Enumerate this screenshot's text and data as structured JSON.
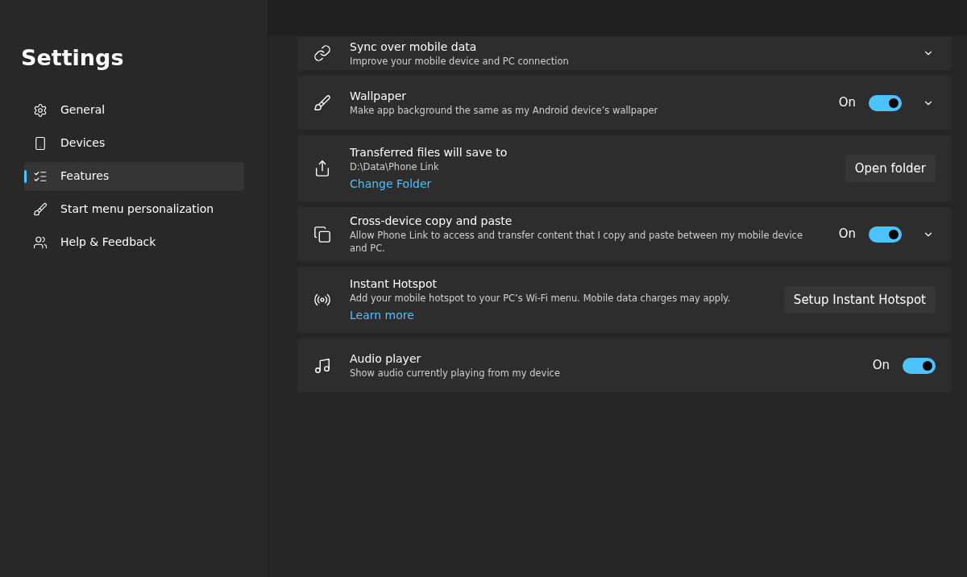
{
  "sidebar": {
    "title": "Settings",
    "items": [
      {
        "label": "General",
        "selected": false
      },
      {
        "label": "Devices",
        "selected": false
      },
      {
        "label": "Features",
        "selected": true
      },
      {
        "label": "Start menu personalization",
        "selected": false
      },
      {
        "label": "Help & Feedback",
        "selected": false
      }
    ]
  },
  "cards": [
    {
      "title": "Sync over mobile data",
      "description": "Improve your mobile device and PC connection",
      "expandable": true
    },
    {
      "title": "Wallpaper",
      "description": "Make app background the same as my Android device’s wallpaper",
      "control": {
        "kind": "toggle",
        "label": "On",
        "on": true
      },
      "expandable": true
    },
    {
      "title": "Transferred files will save to",
      "description": "D:\\Data\\Phone Link",
      "link": "Change Folder",
      "control": {
        "kind": "button",
        "label": "Open folder"
      },
      "expandable": false
    },
    {
      "title": "Cross-device copy and paste",
      "description": "Allow Phone Link to access and transfer content that I copy and paste between my mobile device and PC.",
      "control": {
        "kind": "toggle",
        "label": "On",
        "on": true
      },
      "expandable": true
    },
    {
      "title": "Instant Hotspot",
      "description": "Add your mobile hotspot to your PC’s Wi-Fi menu. Mobile data charges may apply.",
      "link": "Learn more",
      "control": {
        "kind": "button",
        "label": "Setup Instant Hotspot"
      },
      "expandable": false
    },
    {
      "title": "Audio player",
      "description": "Show audio currently playing from my device",
      "control": {
        "kind": "toggle",
        "label": "On",
        "on": true
      },
      "expandable": false
    }
  ]
}
